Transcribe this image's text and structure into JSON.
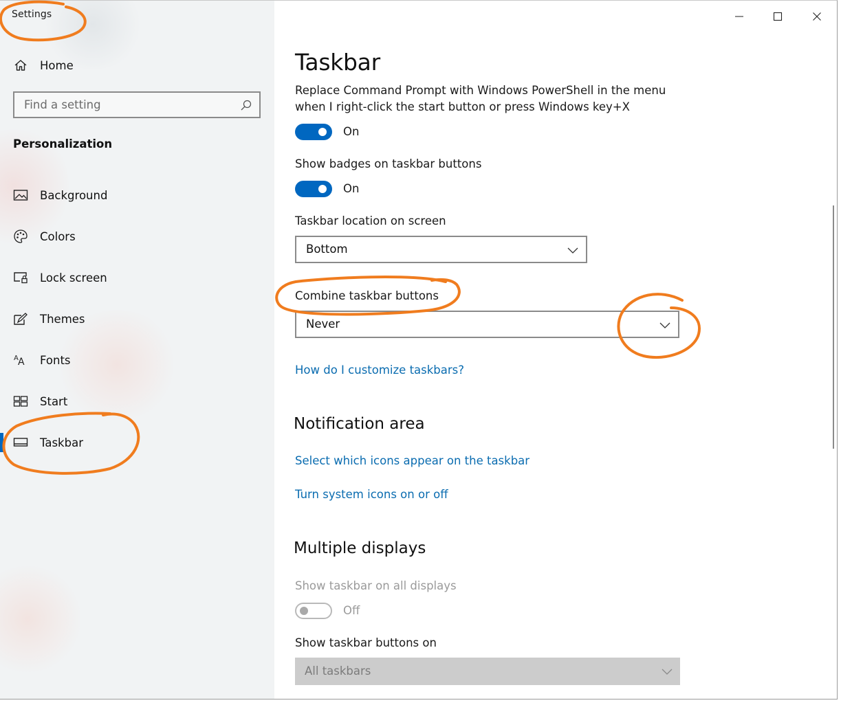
{
  "window": {
    "title": "Settings",
    "controls": [
      "minimize",
      "maximize",
      "close"
    ]
  },
  "sidebar": {
    "home_label": "Home",
    "search_placeholder": "Find a setting",
    "section_label": "Personalization",
    "items": [
      {
        "label": "Background",
        "icon": "picture-icon"
      },
      {
        "label": "Colors",
        "icon": "palette-icon"
      },
      {
        "label": "Lock screen",
        "icon": "lock-screen-icon"
      },
      {
        "label": "Themes",
        "icon": "themes-icon"
      },
      {
        "label": "Fonts",
        "icon": "fonts-icon"
      },
      {
        "label": "Start",
        "icon": "start-icon"
      },
      {
        "label": "Taskbar",
        "icon": "taskbar-icon",
        "selected": true
      }
    ]
  },
  "main": {
    "title": "Taskbar",
    "powershell_setting": {
      "label_line1": "Replace Command Prompt with Windows PowerShell in the menu",
      "label_line2": "when I right-click the start button or press Windows key+X",
      "state": "On"
    },
    "badges_setting": {
      "label": "Show badges on taskbar buttons",
      "state": "On"
    },
    "location_setting": {
      "label": "Taskbar location on screen",
      "value": "Bottom"
    },
    "combine_setting": {
      "label": "Combine taskbar buttons",
      "value": "Never"
    },
    "help_link": "How do I customize taskbars?",
    "notification_area": {
      "heading": "Notification area",
      "link1": "Select which icons appear on the taskbar",
      "link2": "Turn system icons on or off"
    },
    "multiple_displays": {
      "heading": "Multiple displays",
      "all_displays_label": "Show taskbar on all displays",
      "all_displays_state": "Off",
      "buttons_on_label": "Show taskbar buttons on",
      "buttons_on_value": "All taskbars"
    }
  },
  "colors": {
    "accent": "#0067c0",
    "link": "#0a6cb0",
    "annotation": "#f07c1e"
  }
}
